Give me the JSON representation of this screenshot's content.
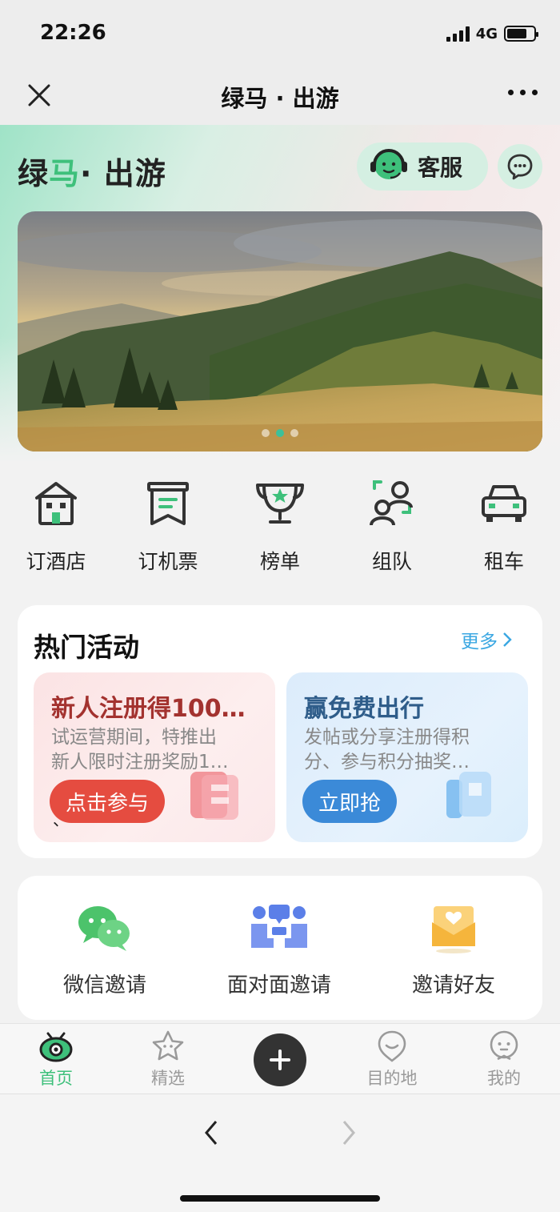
{
  "status": {
    "time": "22:26",
    "network": "4G",
    "battery_level": 0.75
  },
  "nav": {
    "title": "绿马 · 出游",
    "close_icon": "close-icon",
    "more_icon": "more-icon"
  },
  "brand": {
    "part1": "绿",
    "part2": "马",
    "part3": "· 出游",
    "color_green": "#3ec07b"
  },
  "header": {
    "service_label": "客服",
    "service_icon": "headset-agent-icon",
    "chat_icon": "chat-bubble-icon"
  },
  "banner": {
    "image": "mountain-landscape",
    "slide_count": 3,
    "active_slide": 2,
    "dot_active_color": "#3dc09a"
  },
  "shortcuts": [
    {
      "label": "订酒店",
      "icon": "hotel-icon"
    },
    {
      "label": "订机票",
      "icon": "ticket-icon"
    },
    {
      "label": "榜单",
      "icon": "trophy-icon"
    },
    {
      "label": "组队",
      "icon": "team-icon"
    },
    {
      "label": "租车",
      "icon": "car-icon"
    }
  ],
  "activities": {
    "title": "热门活动",
    "more_label": "更多",
    "cards": [
      {
        "title": "新人注册得100…",
        "desc1": "试运营期间，特推出",
        "desc2": "新人限时注册奖励1…",
        "button": "点击参与",
        "extra": "、"
      },
      {
        "title": "赢免费出行",
        "desc1": "发帖或分享注册得积",
        "desc2": "分、参与积分抽奖…",
        "button": "立即抢"
      }
    ]
  },
  "invite": [
    {
      "label": "微信邀请",
      "icon": "wechat-icon"
    },
    {
      "label": "面对面邀请",
      "icon": "face-to-face-icon"
    },
    {
      "label": "邀请好友",
      "icon": "invite-envelope-icon"
    }
  ],
  "tabs": [
    {
      "label": "首页",
      "icon": "home-eye-icon",
      "active": true
    },
    {
      "label": "精选",
      "icon": "star-icon",
      "active": false
    },
    {
      "label": "目的地",
      "icon": "destination-face-icon",
      "active": false
    },
    {
      "label": "我的",
      "icon": "profile-face-icon",
      "active": false
    }
  ],
  "tab_add_icon": "plus-icon",
  "browser": {
    "back_icon": "chevron-left-icon",
    "forward_icon": "chevron-right-icon"
  },
  "colors": {
    "accent": "#3ec07b",
    "link": "#3aa7e2",
    "promo_red": "#e54c40",
    "promo_blue": "#3b8ad8"
  }
}
